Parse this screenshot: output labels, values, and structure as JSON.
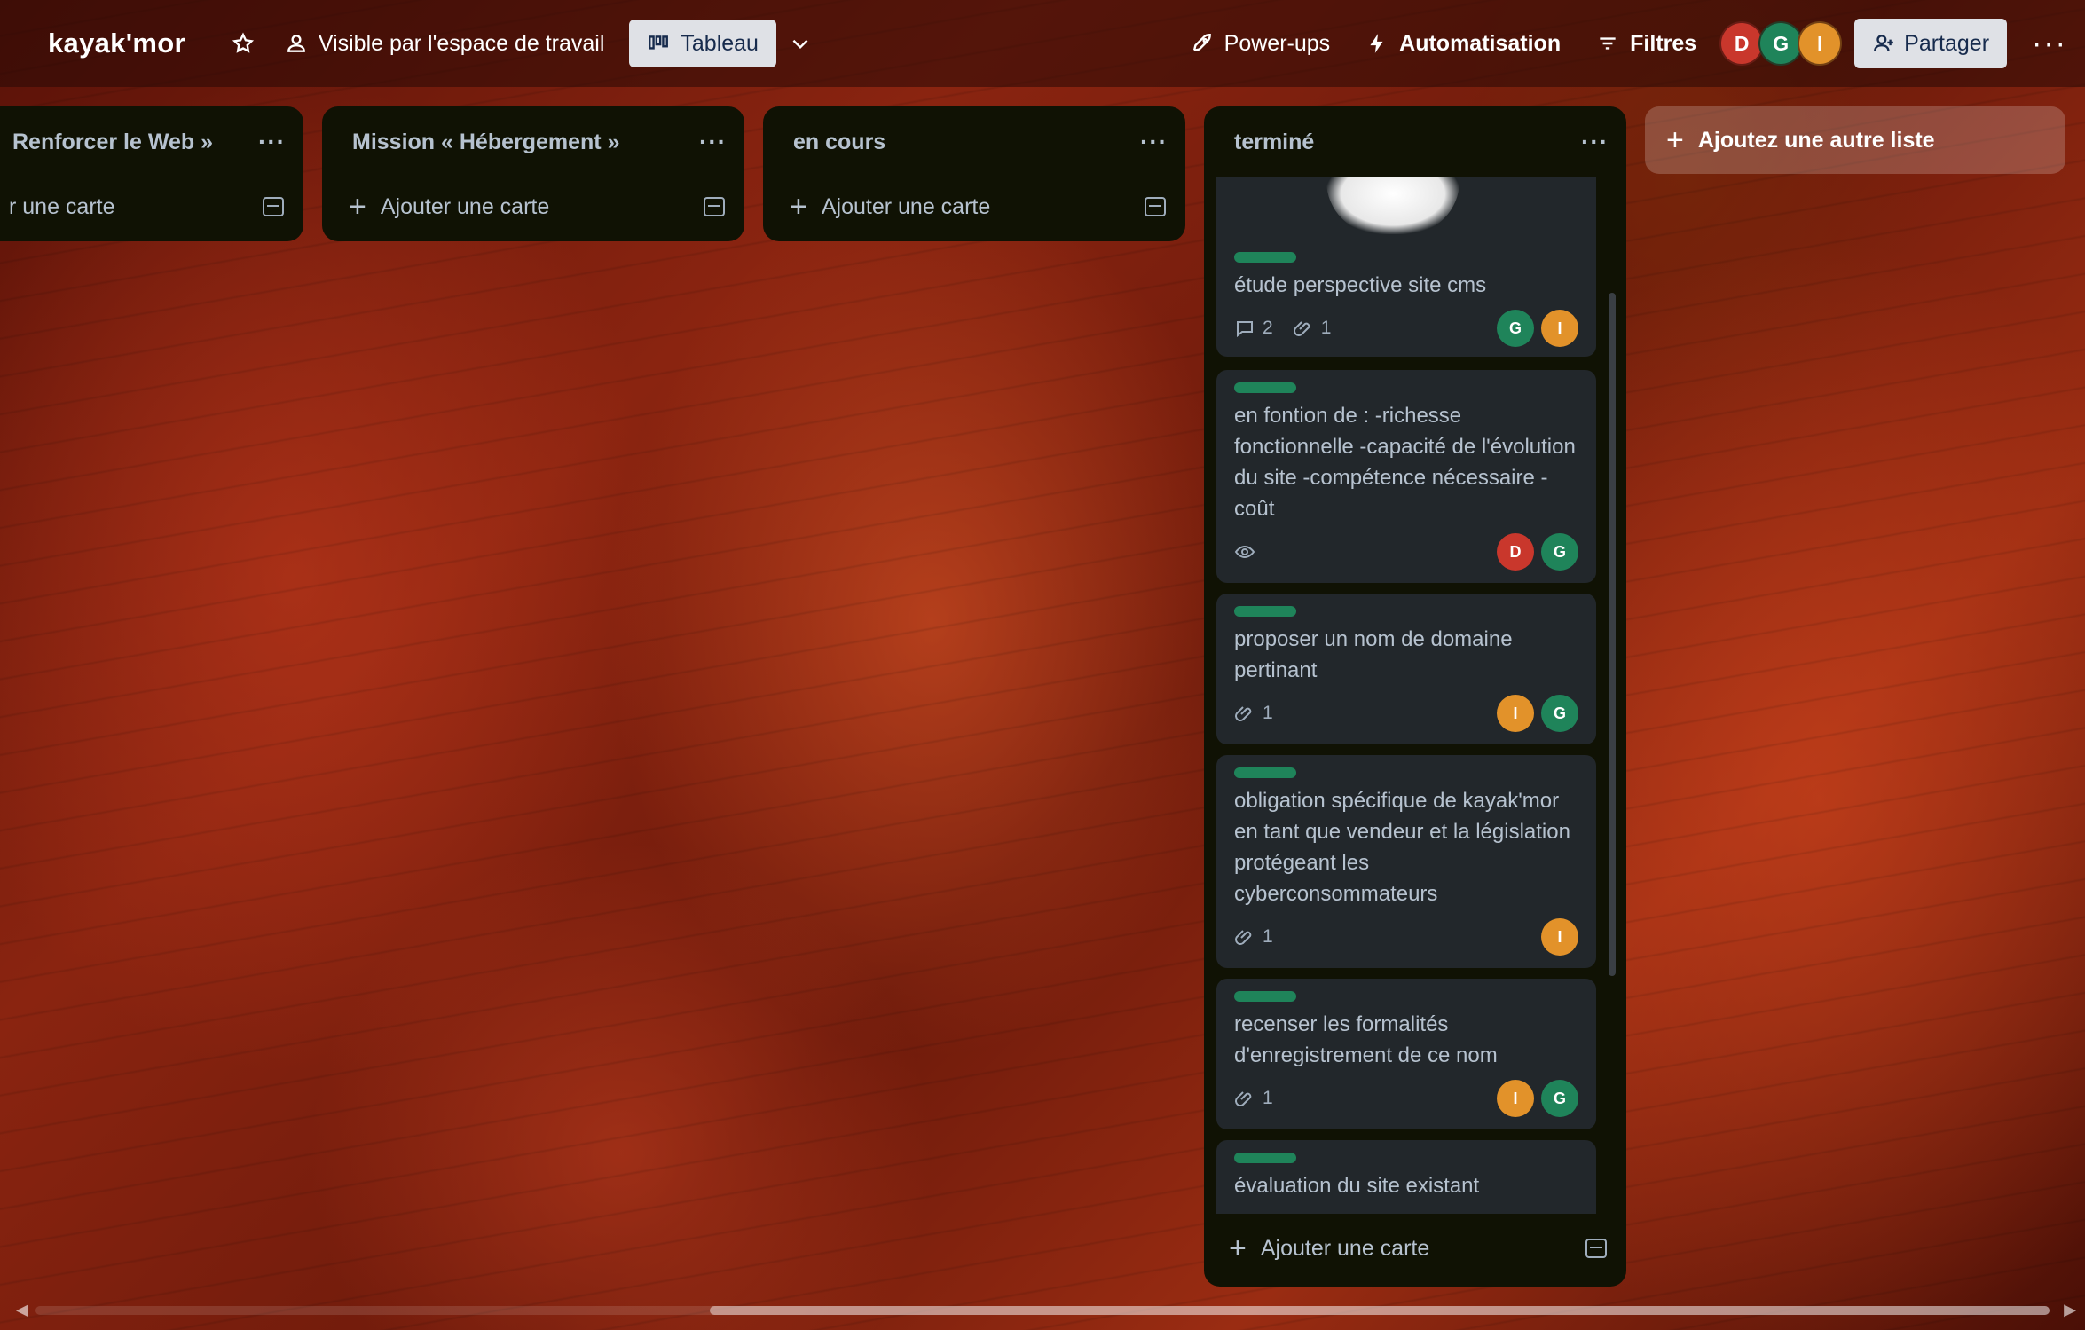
{
  "header": {
    "board_title": "kayak'mor",
    "visibility_label": "Visible par l'espace de travail",
    "view_label": "Tableau",
    "powerups_label": "Power-ups",
    "automation_label": "Automatisation",
    "filters_label": "Filtres",
    "share_label": "Partager",
    "members": [
      "D",
      "G",
      "I"
    ]
  },
  "lists": [
    {
      "title": "Renforcer le Web »",
      "add_label": "r une carte"
    },
    {
      "title": "Mission « Hébergement »",
      "add_label": "Ajouter une carte"
    },
    {
      "title": "en cours",
      "add_label": "Ajouter une carte"
    },
    {
      "title": "terminé",
      "add_label": "Ajouter une carte"
    }
  ],
  "add_list_label": "Ajoutez une autre liste",
  "cards": [
    {
      "title": "étude perspective site cms",
      "comments": "2",
      "attachments": "1",
      "members": [
        "G",
        "I"
      ]
    },
    {
      "title": "en fontion de : -richesse fonctionnelle -capacité de l'évolution du site -compétence nécessaire -coût",
      "watch": true,
      "members": [
        "D",
        "G"
      ]
    },
    {
      "title": "proposer un nom de domaine pertinant",
      "attachments": "1",
      "members": [
        "I",
        "G"
      ]
    },
    {
      "title": "obligation spécifique de kayak'mor en tant que vendeur et la législation protégeant les cyberconsommateurs",
      "attachments": "1",
      "members": [
        "I"
      ]
    },
    {
      "title": "recenser les formalités d'enregistrement de ce nom",
      "attachments": "1",
      "members": [
        "I",
        "G"
      ]
    },
    {
      "title": "évaluation du site existant"
    }
  ],
  "colors": {
    "label_green": "#1f845a",
    "avatar_d": "#c9372c",
    "avatar_g": "#1f845a",
    "avatar_i": "#e2922a",
    "list_bg": "#101204",
    "card_bg": "#22272b"
  }
}
